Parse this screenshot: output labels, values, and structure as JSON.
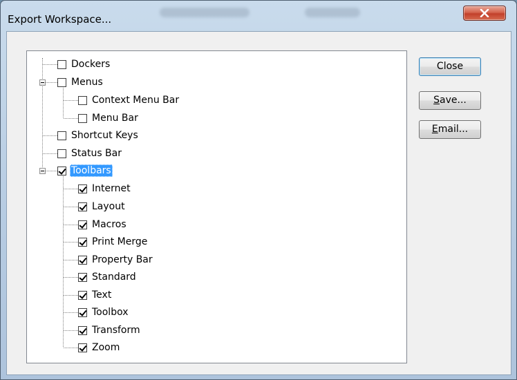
{
  "window": {
    "title": "Export Workspace..."
  },
  "icons": {
    "close": "close-x-icon",
    "expand": "minus-expander-icon"
  },
  "colors": {
    "selection": "#3399ff",
    "close_button": "#c7422c"
  },
  "tree": {
    "items": [
      {
        "label": "Dockers",
        "checked": false
      },
      {
        "label": "Menus",
        "checked": false,
        "expanded": true
      },
      {
        "label": "Context Menu Bar",
        "checked": false
      },
      {
        "label": "Menu Bar",
        "checked": false
      },
      {
        "label": "Shortcut Keys",
        "checked": false
      },
      {
        "label": "Status Bar",
        "checked": false
      },
      {
        "label": "Toolbars",
        "checked": true,
        "expanded": true,
        "selected": true
      },
      {
        "label": "Internet",
        "checked": true
      },
      {
        "label": "Layout",
        "checked": true
      },
      {
        "label": "Macros",
        "checked": true
      },
      {
        "label": "Print Merge",
        "checked": true
      },
      {
        "label": "Property Bar",
        "checked": true
      },
      {
        "label": "Standard",
        "checked": true
      },
      {
        "label": "Text",
        "checked": true
      },
      {
        "label": "Toolbox",
        "checked": true
      },
      {
        "label": "Transform",
        "checked": true
      },
      {
        "label": "Zoom",
        "checked": true
      }
    ]
  },
  "buttons": {
    "close": "Close",
    "save_mnemonic": "S",
    "save_rest": "ave...",
    "email_mnemonic": "E",
    "email_rest": "mail..."
  }
}
